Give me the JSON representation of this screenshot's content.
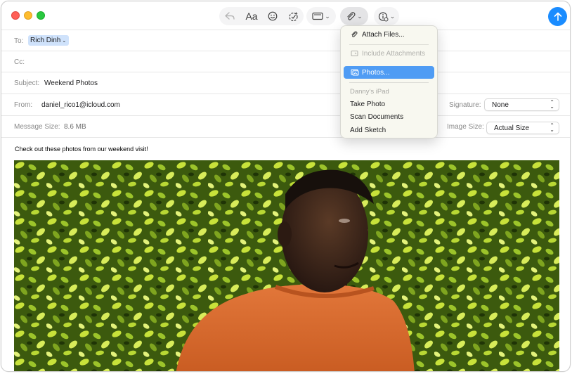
{
  "toolbar": {
    "format_label": "Aa",
    "chevron": "⌄",
    "icons": [
      "reply-icon",
      "format-text-icon",
      "emoji-icon",
      "smart-reply-icon",
      "photo-browser-icon",
      "attach-icon",
      "more-actions-icon",
      "send-icon"
    ]
  },
  "header": {
    "to_label": "To:",
    "to_value": "Rich Dinh",
    "cc_label": "Cc:",
    "subject_label": "Subject:",
    "subject_value": "Weekend Photos",
    "from_label": "From:",
    "from_value": "daniel_rico1@icloud.com",
    "signature_label": "Signature:",
    "signature_value": "None",
    "message_size_label": "Message Size:",
    "message_size_value": "8.6 MB",
    "image_size_label": "Image Size:",
    "image_size_value": "Actual Size"
  },
  "body": {
    "text": "Check out these photos from our weekend visit!"
  },
  "attach_menu": {
    "items": [
      {
        "label": "Attach Files...",
        "state": "normal"
      },
      {
        "label": "Include Attachments",
        "state": "disabled"
      },
      {
        "label": "Photos...",
        "state": "highlighted"
      }
    ],
    "device_header": "Danny’s iPad",
    "device_items": [
      "Take Photo",
      "Scan Documents",
      "Add Sketch"
    ]
  },
  "colors": {
    "send_button": "#1a8cff",
    "highlight": "#4f9cf4",
    "token": "#cfe2fb"
  }
}
